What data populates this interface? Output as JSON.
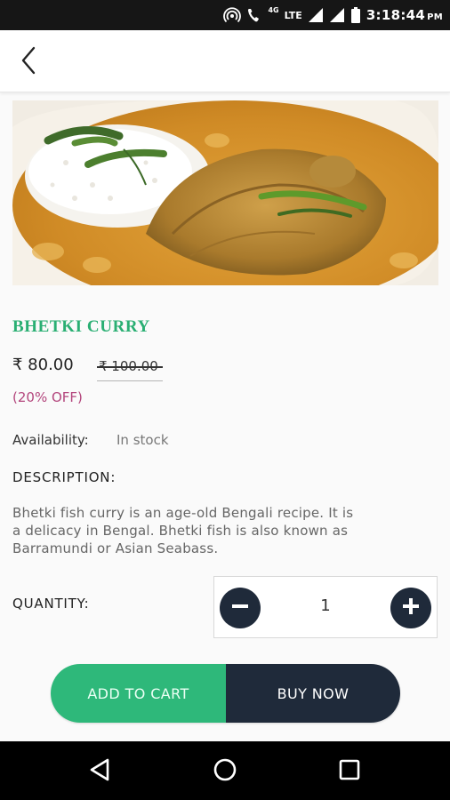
{
  "status_bar": {
    "network_small": "4G",
    "network": "LTE",
    "time": "3:18:44",
    "ampm": "PM"
  },
  "app_bar": {
    "back_icon": "chevron-left-icon"
  },
  "product": {
    "image_icon": "fish-curry-photo",
    "title": "BHETKI CURRY",
    "price": "₹ 80.00",
    "original_price": "₹ 100.00",
    "discount": "(20% OFF)",
    "availability_label": "Availability:",
    "availability_value": "In stock",
    "description_heading": "DESCRIPTION:",
    "description_lines": [
      "Bhetki fish curry is an age-old Bengali recipe. It is",
      "a delicacy in Bengal. Bhetki fish is also known as",
      "Barramundi or Asian Seabass."
    ]
  },
  "quantity": {
    "label": "QUANTITY:",
    "value": "1",
    "minus_icon": "minus-circle-icon",
    "plus_icon": "plus-circle-icon"
  },
  "actions": {
    "add_to_cart": "ADD TO CART",
    "buy_now": "BUY NOW"
  },
  "colors": {
    "accent_green": "#2eb87a",
    "title_green": "#2aaf73",
    "dark_navy": "#1f2a3a",
    "discount_pink": "#b3457c"
  },
  "nav_bar": {
    "back_icon": "triangle-back-icon",
    "home_icon": "circle-home-icon",
    "recents_icon": "square-recents-icon"
  }
}
